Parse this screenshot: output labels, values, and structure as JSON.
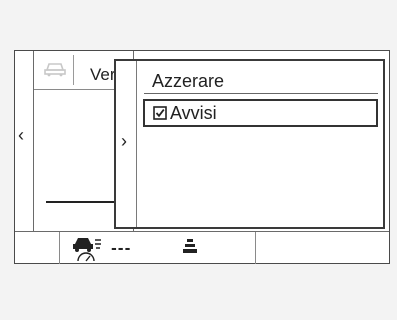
{
  "panel": {
    "tab_label": "Ver",
    "car_icon": "car-icon",
    "left_arrow": "‹"
  },
  "popup": {
    "back_arrow": "›",
    "title": "Azzerare",
    "items": [
      {
        "label": "Avvisi",
        "checked": true
      }
    ]
  },
  "status_bar": {
    "cruise_icon": "adaptive-cruise-icon",
    "speed_placeholder": "---",
    "lane_icon": "lane-assist-icon"
  }
}
